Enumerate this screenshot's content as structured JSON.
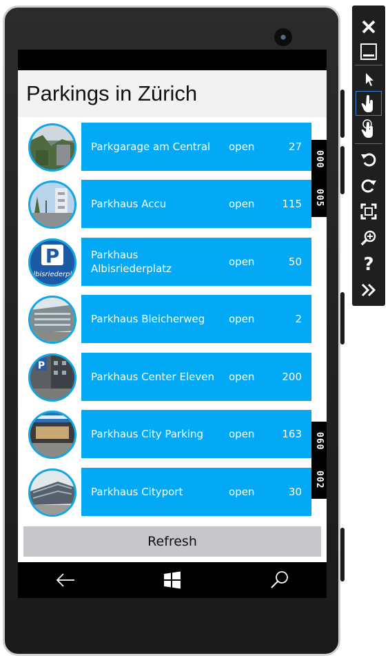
{
  "header": {
    "title": "Parkings in Zürich"
  },
  "parkings": [
    {
      "name": "Parkgarage am Central",
      "status": "open",
      "free": "27",
      "thumb": "garage-greenery"
    },
    {
      "name": "Parkhaus Accu",
      "status": "open",
      "free": "115",
      "thumb": "street-tower"
    },
    {
      "name": "Parkhaus Albisriederplatz",
      "status": "open",
      "free": "50",
      "thumb": "parking-sign",
      "thumb_text": "Albisriederpla"
    },
    {
      "name": "Parkhaus Bleicherweg",
      "status": "open",
      "free": "2",
      "thumb": "office-building"
    },
    {
      "name": "Parkhaus Center Eleven",
      "status": "open",
      "free": "200",
      "thumb": "parking-sign-building"
    },
    {
      "name": "Parkhaus City Parking",
      "status": "open",
      "free": "163",
      "thumb": "city-parking-entrance"
    },
    {
      "name": "Parkhaus Cityport",
      "status": "open",
      "free": "30",
      "thumb": "glass-building"
    }
  ],
  "actions": {
    "refresh_label": "Refresh"
  },
  "counters": [
    "000",
    "005",
    "060",
    "002"
  ],
  "navbar": {
    "back": "back-arrow-icon",
    "start": "windows-logo-icon",
    "search": "search-icon"
  },
  "toolbar": {
    "items": [
      "close-icon",
      "minimize-icon",
      "pointer-icon",
      "single-touch-icon",
      "multi-touch-icon",
      "rotate-left-icon",
      "rotate-right-icon",
      "fit-to-screen-icon",
      "zoom-icon",
      "help-icon",
      "more-tools-icon"
    ]
  },
  "colors": {
    "accent": "#03a9f4",
    "avatar_border": "#11a6e6",
    "header_bg": "#f2f2f2",
    "refresh_bg": "#c6c6cb"
  }
}
